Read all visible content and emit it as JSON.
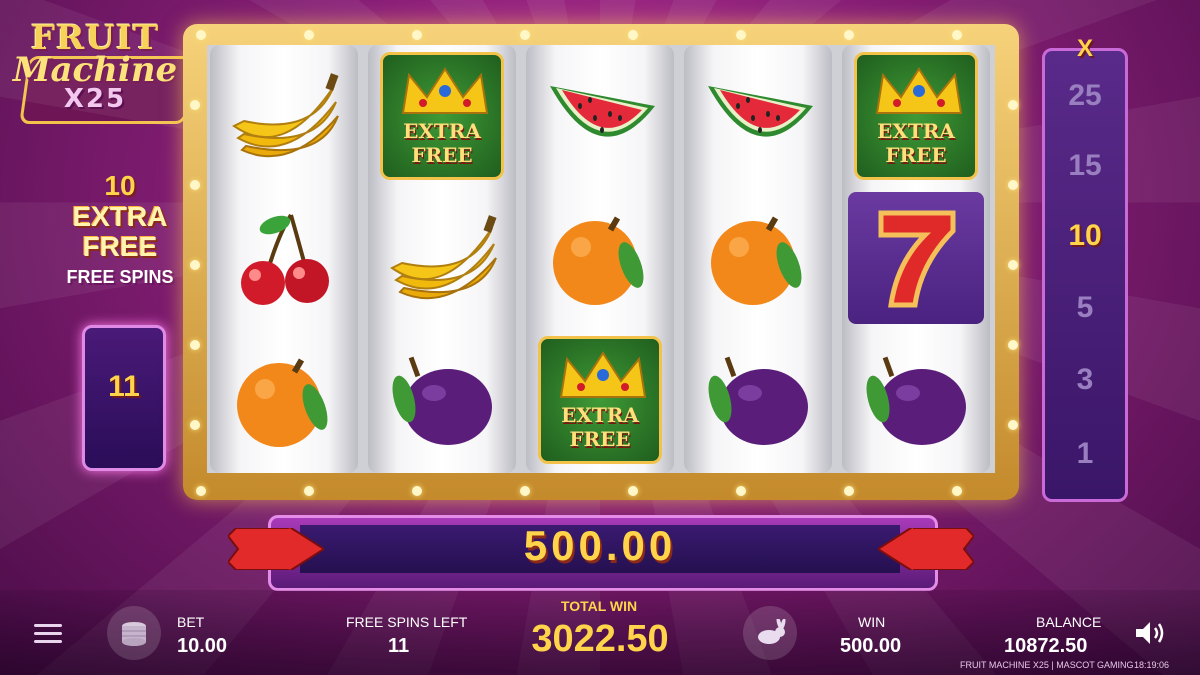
{
  "logo": {
    "line1": "FRUIT",
    "line2": "Machine",
    "line3": "X25"
  },
  "extra_panel": {
    "count": "10",
    "title": "EXTRA FREE",
    "subtitle": "FREE SPINS",
    "counter": "11"
  },
  "reels": [
    [
      "banana",
      "cherries",
      "orange"
    ],
    [
      "extra-free-crown",
      "banana",
      "plum"
    ],
    [
      "watermelon",
      "orange",
      "extra-free-crown"
    ],
    [
      "watermelon",
      "orange",
      "plum"
    ],
    [
      "extra-free-crown",
      "seven",
      "plum"
    ]
  ],
  "symbols": {
    "extra_free_line1": "EXTRA",
    "extra_free_line2": "FREE",
    "seven": "7"
  },
  "multiplier": {
    "label": "X",
    "values": [
      "25",
      "15",
      "10",
      "5",
      "3",
      "1"
    ],
    "active": "10"
  },
  "win_bar": {
    "value": "500.00"
  },
  "bottom": {
    "bet_label": "BET",
    "bet_value": "10.00",
    "free_spins_label": "FREE SPINS LEFT",
    "free_spins_value": "11",
    "total_win_label": "TOTAL WIN",
    "total_win_value": "3022.50",
    "win_label": "WIN",
    "win_value": "500.00",
    "balance_label": "BALANCE",
    "balance_value": "10872.50",
    "footer_game": "FRUIT MACHINE X25 | MASCOT GAMING",
    "footer_time": "18:19:06"
  },
  "colors": {
    "gold": "#ffd34a",
    "purple": "#8a1f78",
    "reel_bg": "#ffffff"
  }
}
